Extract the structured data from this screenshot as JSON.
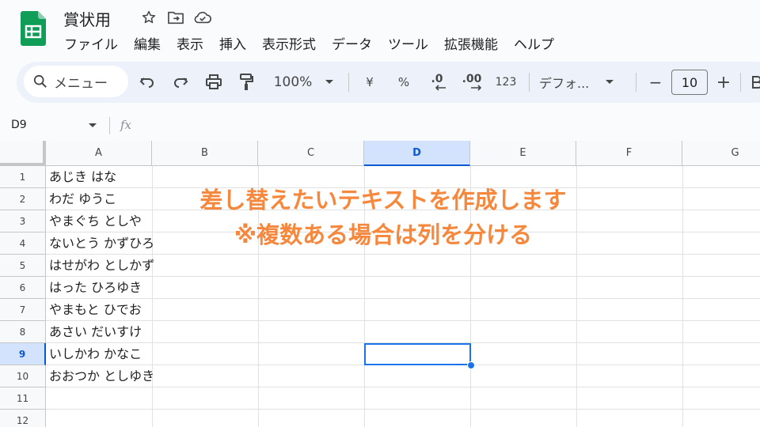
{
  "doc": {
    "title": "賞状用"
  },
  "menu": [
    "ファイル",
    "編集",
    "表示",
    "挿入",
    "表示形式",
    "データ",
    "ツール",
    "拡張機能",
    "ヘルプ"
  ],
  "toolbar": {
    "search_label": "メニュー",
    "zoom": "100%",
    "currency": "¥",
    "percent": "%",
    "dec_decrease": ".0",
    "dec_increase": ".00",
    "format_123": "123",
    "font": "デフォ...",
    "font_size": "10",
    "minus": "−",
    "plus": "+"
  },
  "formula_bar": {
    "name_box": "D9",
    "fx": "fx"
  },
  "columns": [
    "A",
    "B",
    "C",
    "D",
    "E",
    "F",
    "G"
  ],
  "selected_column": "D",
  "rows": [
    "1",
    "2",
    "3",
    "4",
    "5",
    "6",
    "7",
    "8",
    "9",
    "10",
    "11",
    "12"
  ],
  "selected_row": "9",
  "cells_a": [
    "あじき はな",
    "わだ ゆうこ",
    "やまぐち としや",
    "ないとう かずひろ",
    "はせがわ としかず",
    "はった ひろゆき",
    "やまもと ひでお",
    "あさい だいすけ",
    "いしかわ かなこ",
    "おおつか としゆき"
  ],
  "overlay": {
    "line1": "差し替えたいテキストを作成します",
    "line2": "※複数ある場合は列を分ける",
    "color": "#f5883c"
  }
}
